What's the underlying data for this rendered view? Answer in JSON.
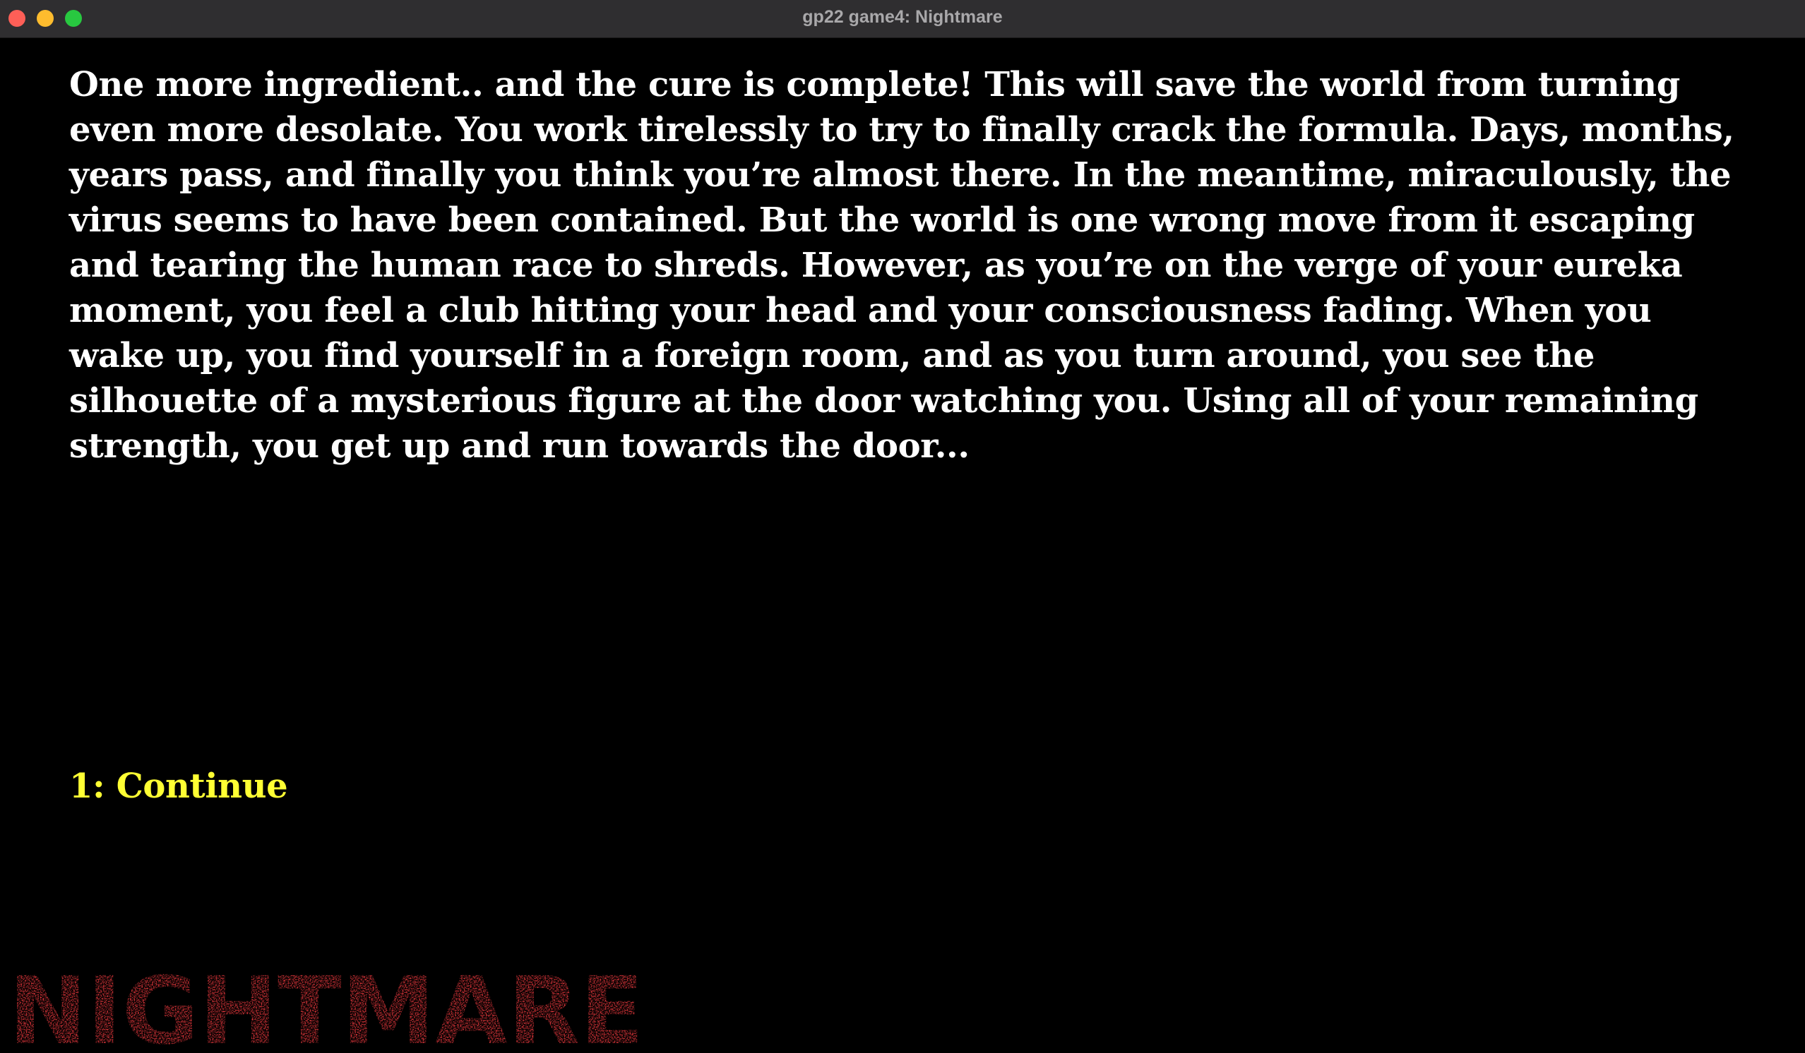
{
  "window": {
    "title": "gp22 game4: Nightmare"
  },
  "story": {
    "text": "One more ingredient.. and the cure is complete! This will save the world from turning even more desolate. You work tirelessly to try to finally crack the formula. Days, months, years pass, and finally you think you’re almost there. In the meantime, miraculously, the virus seems to have been contained. But the world is one wrong move from it escaping and tearing the human race to shreds. However, as you’re on the verge of your eureka moment, you feel a club hitting your head and your consciousness fading. When you wake up, you find yourself in a foreign room, and as you turn around, you see the silhouette of a mysterious figure at the door watching you. Using all of your remaining strength, you get up and run towards the door..."
  },
  "choices": [
    {
      "label": "1: Continue"
    }
  ],
  "logo": {
    "text": "NIGHTMARE",
    "color": "#e8383d"
  },
  "colors": {
    "background": "#000000",
    "story_text": "#ffffff",
    "choice_text": "#ffff33",
    "titlebar": "#2f2e30"
  }
}
